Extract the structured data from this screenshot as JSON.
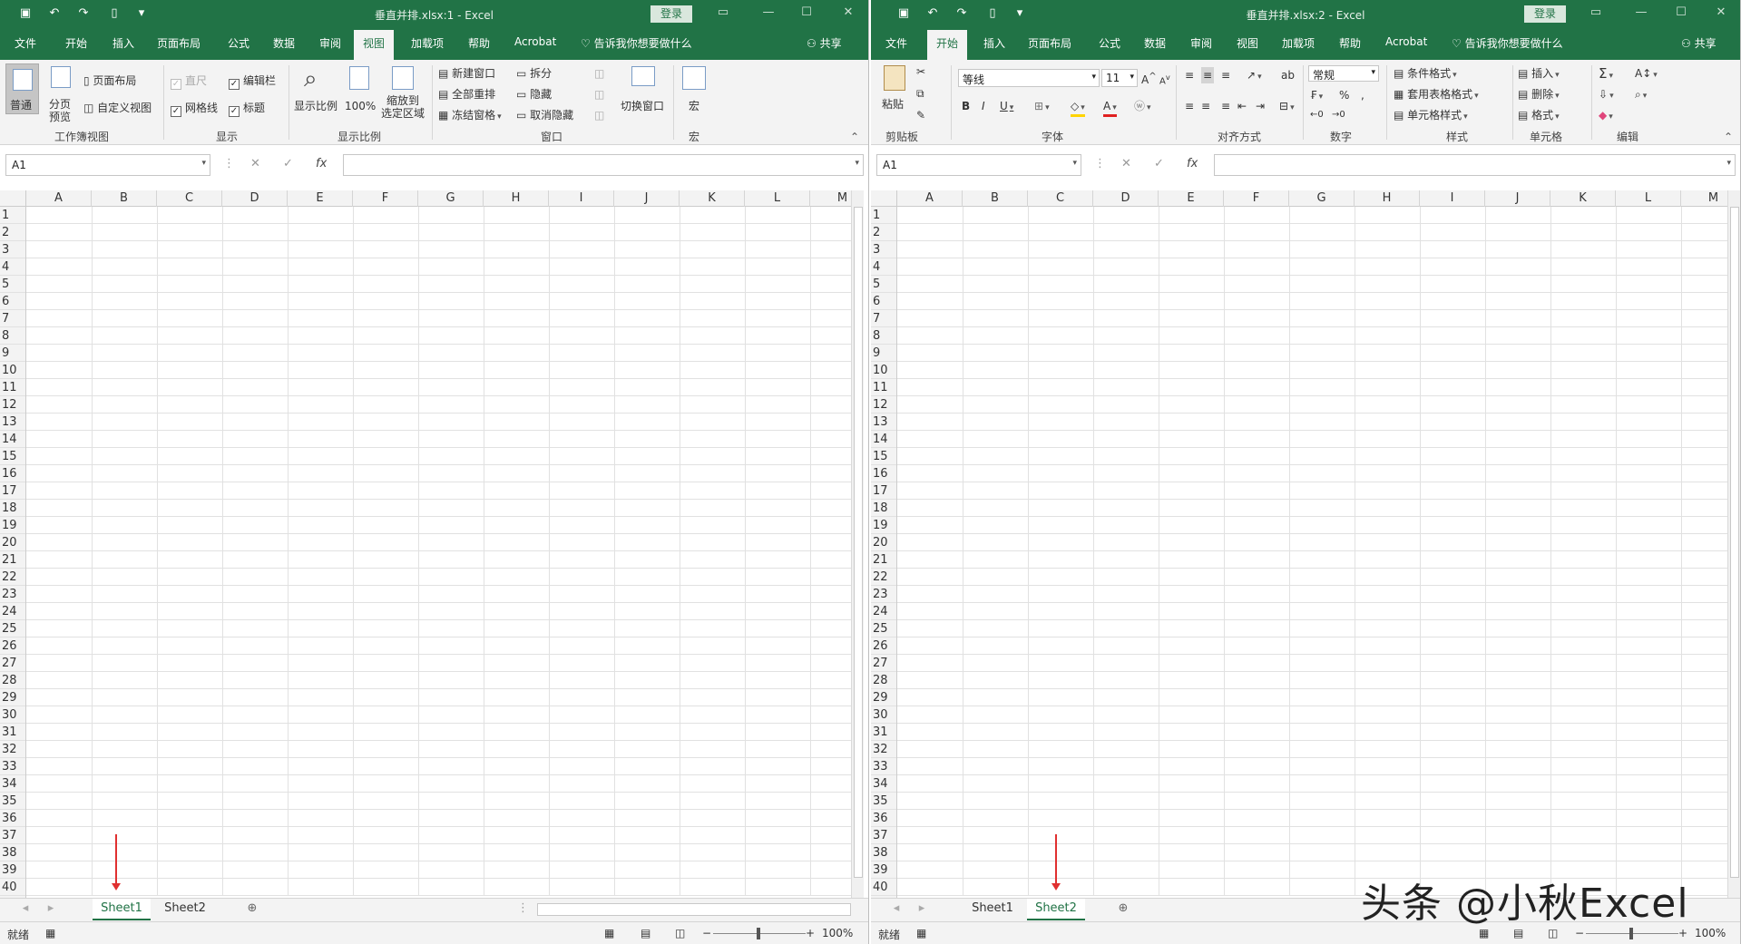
{
  "watermark": "头条 @小秋Excel",
  "left": {
    "title": "垂直并排.xlsx:1  -  Excel",
    "login": "登录",
    "tabs": [
      "文件",
      "开始",
      "插入",
      "页面布局",
      "公式",
      "数据",
      "审阅",
      "视图",
      "加载项",
      "帮助",
      "Acrobat"
    ],
    "active_tab": "视图",
    "tell_me": "告诉我你想要做什么",
    "share": "共享",
    "ribbon": {
      "normal": "普通",
      "page_break": "分页\n预览",
      "page_layout": "页面布局",
      "custom_views": "自定义视图",
      "group_workbook_views": "工作簿视图",
      "ruler": "直尺",
      "formula_bar": "编辑栏",
      "gridlines": "网格线",
      "headings": "标题",
      "group_show": "显示",
      "zoom": "显示比例",
      "zoom100": "100%",
      "zoom_selection": "缩放到\n选定区域",
      "group_zoom": "显示比例",
      "new_window": "新建窗口",
      "arrange_all": "全部重排",
      "freeze_panes": "冻结窗格",
      "split": "拆分",
      "hide": "隐藏",
      "unhide": "取消隐藏",
      "switch_windows": "切换窗口",
      "group_window": "窗口",
      "macros": "宏",
      "group_macros": "宏"
    },
    "namebox": "A1",
    "sheets": [
      "Sheet1",
      "Sheet2"
    ],
    "active_sheet": "Sheet1",
    "status": "就绪",
    "zoom": "100%"
  },
  "right": {
    "title": "垂直并排.xlsx:2  -  Excel",
    "login": "登录",
    "tabs": [
      "文件",
      "开始",
      "插入",
      "页面布局",
      "公式",
      "数据",
      "审阅",
      "视图",
      "加载项",
      "帮助",
      "Acrobat"
    ],
    "active_tab": "开始",
    "tell_me": "告诉我你想要做什么",
    "share": "共享",
    "ribbon": {
      "paste": "粘贴",
      "group_clipboard": "剪贴板",
      "font_name": "等线",
      "font_size": "11",
      "group_font": "字体",
      "group_alignment": "对齐方式",
      "number_format": "常规",
      "group_number": "数字",
      "conditional": "条件格式",
      "format_table": "套用表格格式",
      "cell_styles": "单元格样式",
      "group_styles": "样式",
      "insert": "插入",
      "delete": "删除",
      "format": "格式",
      "group_cells": "单元格",
      "group_editing": "编辑"
    },
    "namebox": "A1",
    "sheets": [
      "Sheet1",
      "Sheet2"
    ],
    "active_sheet": "Sheet2",
    "status": "就绪",
    "zoom": "100%"
  },
  "columns": [
    "A",
    "B",
    "C",
    "D",
    "E",
    "F",
    "G",
    "H",
    "I",
    "J",
    "K",
    "L",
    "M"
  ],
  "rows": [
    "1",
    "2",
    "3",
    "4",
    "5",
    "6",
    "7",
    "8",
    "9",
    "10",
    "11",
    "12",
    "13",
    "14",
    "15",
    "16",
    "17",
    "18",
    "19",
    "20",
    "21",
    "22",
    "23",
    "24",
    "25",
    "26",
    "27",
    "28",
    "29",
    "30",
    "31",
    "32",
    "33",
    "34",
    "35",
    "36",
    "37",
    "38",
    "39",
    "40"
  ],
  "colors": {
    "accent": "#217346",
    "arrow": "#e03030"
  }
}
